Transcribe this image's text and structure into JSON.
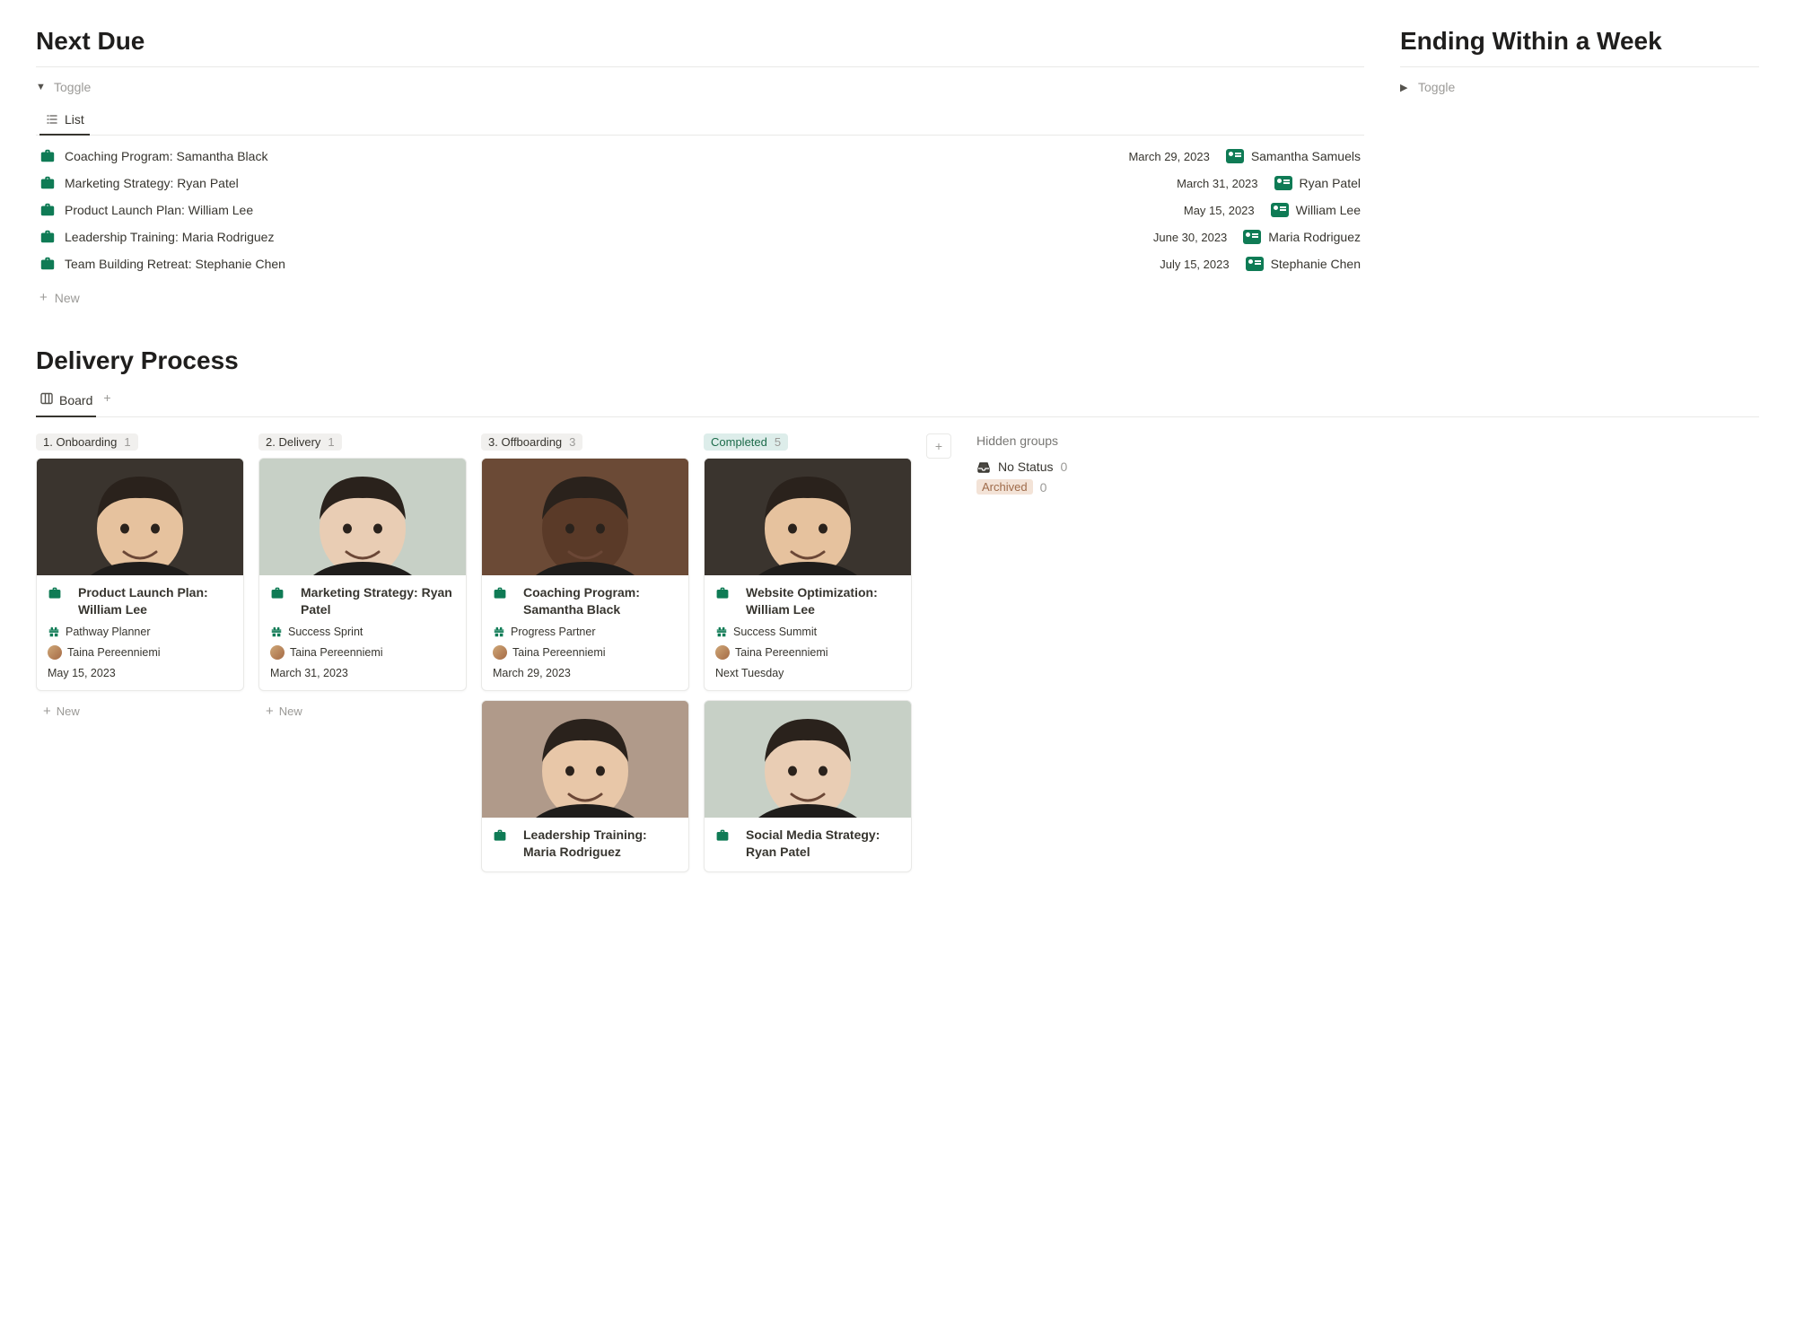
{
  "sections": {
    "next_due": {
      "title": "Next Due",
      "toggle": "Toggle",
      "view": "List"
    },
    "ending": {
      "title": "Ending Within a Week",
      "toggle": "Toggle"
    },
    "delivery": {
      "title": "Delivery Process",
      "view": "Board"
    }
  },
  "list_items": [
    {
      "title": "Coaching Program: Samantha Black",
      "date": "March 29, 2023",
      "person": "Samantha Samuels"
    },
    {
      "title": "Marketing Strategy: Ryan Patel",
      "date": "March 31, 2023",
      "person": "Ryan Patel"
    },
    {
      "title": "Product Launch Plan: William Lee",
      "date": "May 15, 2023",
      "person": "William Lee"
    },
    {
      "title": "Leadership Training: Maria Rodriguez",
      "date": "June 30, 2023",
      "person": "Maria Rodriguez"
    },
    {
      "title": "Team Building Retreat: Stephanie Chen",
      "date": "July 15, 2023",
      "person": "Stephanie Chen"
    }
  ],
  "new_label": "New",
  "board_columns": [
    {
      "label": "1. Onboarding",
      "count": "1",
      "class": "ch-onboarding"
    },
    {
      "label": "2. Delivery",
      "count": "1",
      "class": "ch-delivery"
    },
    {
      "label": "3. Offboarding",
      "count": "3",
      "class": "ch-offboarding"
    },
    {
      "label": "Completed",
      "count": "5",
      "class": "ch-completed"
    }
  ],
  "cards": {
    "onboarding": [
      {
        "title": "Product Launch Plan: William Lee",
        "package": "Pathway Planner",
        "assignee": "Taina Pereenniemi",
        "date": "May 15, 2023",
        "img_bg": "#3a342e"
      }
    ],
    "delivery": [
      {
        "title": "Marketing Strategy: Ryan Patel",
        "package": "Success Sprint",
        "assignee": "Taina Pereenniemi",
        "date": "March 31, 2023",
        "img_bg": "#c7d0c6"
      }
    ],
    "offboarding": [
      {
        "title": "Coaching Program: Samantha Black",
        "package": "Progress Partner",
        "assignee": "Taina Pereenniemi",
        "date": "March 29, 2023",
        "img_bg": "#6b4a36"
      },
      {
        "title": "Leadership Training: Maria Rodriguez",
        "package": "",
        "assignee": "",
        "date": "",
        "img_bg": "#b09a8a"
      }
    ],
    "completed": [
      {
        "title": "Website Optimization: William Lee",
        "package": "Success Summit",
        "assignee": "Taina Pereenniemi",
        "date": "Next Tuesday",
        "img_bg": "#3a342e"
      },
      {
        "title": "Social Media Strategy: Ryan Patel",
        "package": "",
        "assignee": "",
        "date": "",
        "img_bg": "#c7d0c6"
      }
    ]
  },
  "hidden_groups": {
    "label": "Hidden groups",
    "items": [
      {
        "label": "No Status",
        "count": "0",
        "type": "inbox"
      },
      {
        "label": "Archived",
        "count": "0",
        "type": "badge"
      }
    ]
  }
}
